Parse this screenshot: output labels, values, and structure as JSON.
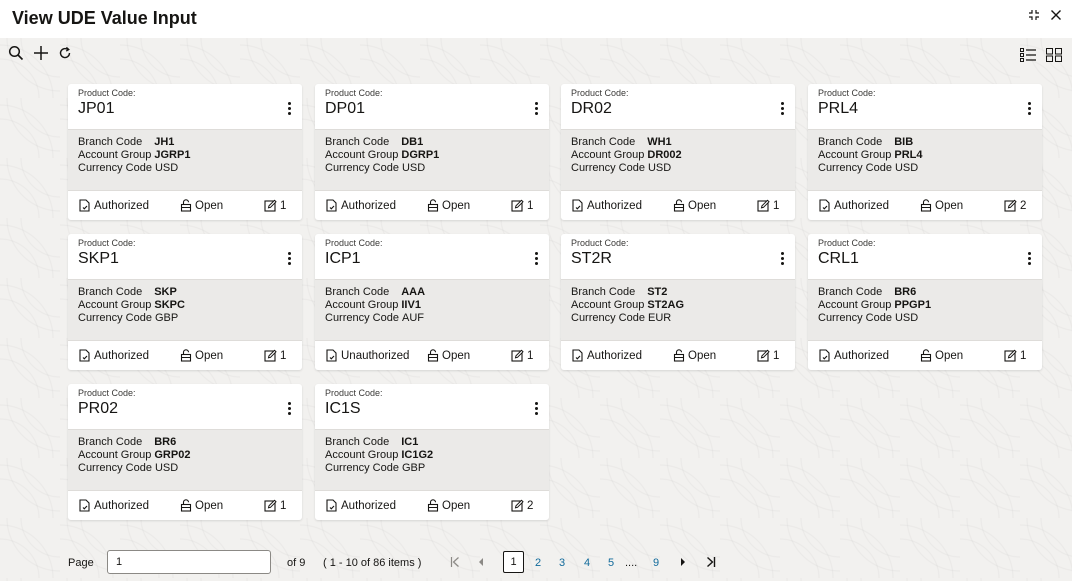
{
  "window": {
    "title": "View UDE Value Input"
  },
  "toolbar": {
    "search": "search-icon",
    "add": "add-icon",
    "refresh": "refresh-icon"
  },
  "view_toggle": {
    "list": "list-view-icon",
    "tile": "tile-view-icon"
  },
  "card_labels": {
    "product_code": "Product Code:",
    "branch_code": "Branch Code",
    "account_group": "Account Group",
    "currency_code": "Currency Code",
    "open": "Open"
  },
  "cards": [
    {
      "product_code": "JP01",
      "branch_code": "JH1",
      "account_group": "JGRP1",
      "currency_code": "USD",
      "status": "Authorized",
      "versions": "1"
    },
    {
      "product_code": "DP01",
      "branch_code": "DB1",
      "account_group": "DGRP1",
      "currency_code": "USD",
      "status": "Authorized",
      "versions": "1"
    },
    {
      "product_code": "DR02",
      "branch_code": "WH1",
      "account_group": "DR002",
      "currency_code": "USD",
      "status": "Authorized",
      "versions": "1"
    },
    {
      "product_code": "PRL4",
      "branch_code": "BIB",
      "account_group": "PRL4",
      "currency_code": "USD",
      "status": "Authorized",
      "versions": "2"
    },
    {
      "product_code": "SKP1",
      "branch_code": "SKP",
      "account_group": "SKPC",
      "currency_code": "GBP",
      "status": "Authorized",
      "versions": "1"
    },
    {
      "product_code": "ICP1",
      "branch_code": "AAA",
      "account_group": "IIV1",
      "currency_code": "AUF",
      "status": "Unauthorized",
      "versions": "1"
    },
    {
      "product_code": "ST2R",
      "branch_code": "ST2",
      "account_group": "ST2AG",
      "currency_code": "EUR",
      "status": "Authorized",
      "versions": "1"
    },
    {
      "product_code": "CRL1",
      "branch_code": "BR6",
      "account_group": "PPGP1",
      "currency_code": "USD",
      "status": "Authorized",
      "versions": "1"
    },
    {
      "product_code": "PR02",
      "branch_code": "BR6",
      "account_group": "GRP02",
      "currency_code": "USD",
      "status": "Authorized",
      "versions": "1"
    },
    {
      "product_code": "IC1S",
      "branch_code": "IC1",
      "account_group": "IC1G2",
      "currency_code": "GBP",
      "status": "Authorized",
      "versions": "2"
    }
  ],
  "pagination": {
    "page_label": "Page",
    "page_value": "1",
    "of_pages": "of 9",
    "items_summary": "( 1 - 10 of 86 items )",
    "pages": [
      "1",
      "2",
      "3",
      "4",
      "5",
      "....",
      "9"
    ],
    "current": "1"
  }
}
